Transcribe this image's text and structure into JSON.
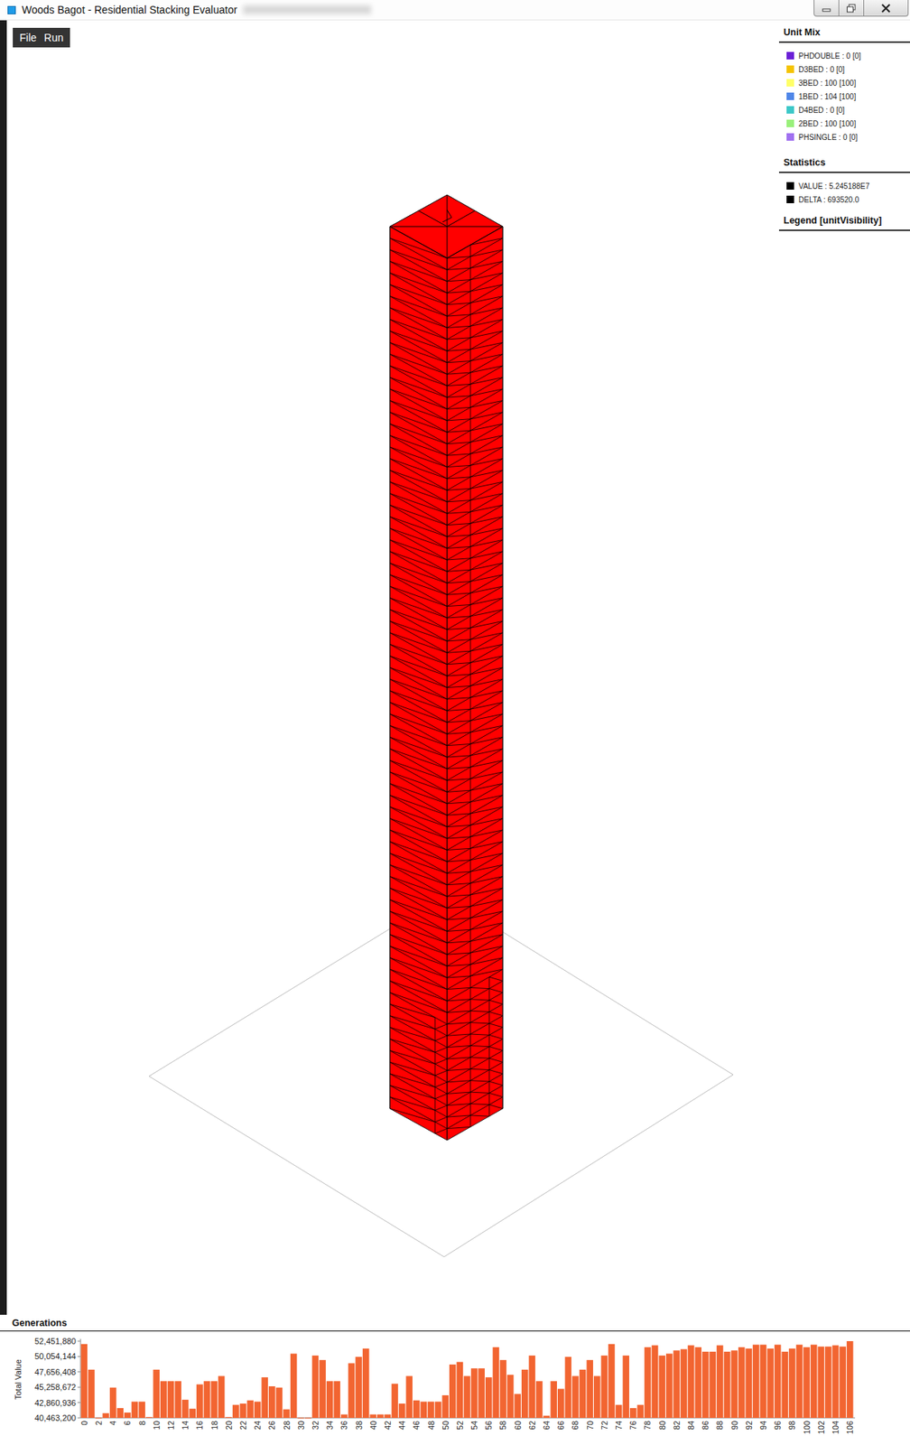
{
  "window": {
    "title": "Woods Bagot - Residential Stacking Evaluator"
  },
  "menu": [
    {
      "label": "File"
    },
    {
      "label": "Run"
    }
  ],
  "unit_mix": {
    "title": "Unit Mix",
    "items": [
      {
        "label": "PHDOUBLE : 0 [0]",
        "color": "#6a1fd6"
      },
      {
        "label": "D3BED : 0 [0]",
        "color": "#f5c400"
      },
      {
        "label": "3BED : 100 [100]",
        "color": "#ffff66"
      },
      {
        "label": "1BED : 104 [100]",
        "color": "#4f86e8"
      },
      {
        "label": "D4BED : 0 [0]",
        "color": "#3cc8c8"
      },
      {
        "label": "2BED : 100 [100]",
        "color": "#99f07a"
      },
      {
        "label": "PHSINGLE : 0 [0]",
        "color": "#a070f0"
      }
    ]
  },
  "statistics": {
    "title": "Statistics",
    "items": [
      {
        "label": "VALUE : 5.245188E7",
        "color": "#000000"
      },
      {
        "label": "DELTA : 693520.0",
        "color": "#000000"
      }
    ]
  },
  "legend": {
    "title": "Legend [unitVisibility]"
  },
  "generations": {
    "title": "Generations",
    "chart": {
      "y_axis_title": "Total Value",
      "y_ticks": [
        "52,451,880",
        "50,054,144",
        "47,656,408",
        "45,258,672",
        "42,860,936",
        "40,463,200"
      ],
      "x_ticks": [
        "0",
        "2",
        "4",
        "6",
        "8",
        "10",
        "12",
        "14",
        "16",
        "18",
        "20",
        "22",
        "24",
        "26",
        "28",
        "30",
        "32",
        "34",
        "36",
        "38",
        "40",
        "42",
        "44",
        "46",
        "48",
        "50",
        "52",
        "54",
        "56",
        "58",
        "60",
        "62",
        "64",
        "66",
        "68",
        "70",
        "72",
        "74",
        "76",
        "78",
        "80",
        "82",
        "84",
        "86",
        "88",
        "90",
        "92",
        "94",
        "96",
        "98",
        "100",
        "102",
        "104",
        "106"
      ],
      "series": [
        {
          "values": [
            52000000,
            48000000,
            40500000,
            41200000,
            45200000,
            42000000,
            41300000,
            43000000,
            43000000,
            40600000,
            48000000,
            46200000,
            46200000,
            46200000,
            43300000,
            41900000,
            45700000,
            46200000,
            46200000,
            47000000,
            40600000,
            42500000,
            42700000,
            43200000,
            43000000,
            46800000,
            45400000,
            45200000,
            41800000,
            50500000,
            40500000,
            40500000,
            50200000,
            49500000,
            46200000,
            46200000,
            41000000,
            49000000,
            50000000,
            51300000,
            41000000,
            41000000,
            41000000,
            45800000,
            42700000,
            47000000,
            43200000,
            43000000,
            43000000,
            43000000,
            44000000,
            48800000,
            49200000,
            47000000,
            48200000,
            48200000,
            46800000,
            51500000,
            49500000,
            47200000,
            44200000,
            48000000,
            50200000,
            46200000,
            40800000,
            46200000,
            45000000,
            50000000,
            47000000,
            48000000,
            49500000,
            47000000,
            50200000,
            52000000,
            42500000,
            50200000,
            42000000,
            42500000,
            51500000,
            51800000,
            50200000,
            50500000,
            51000000,
            51200000,
            51800000,
            51500000,
            50800000,
            50800000,
            51800000,
            50800000,
            51000000,
            51500000,
            51300000,
            51900000,
            51900000,
            51300000,
            51900000,
            50800000,
            51300000,
            51900000,
            51500000,
            51900000,
            51600000,
            51600000,
            51800000,
            51600000,
            52451880
          ]
        }
      ]
    }
  }
}
